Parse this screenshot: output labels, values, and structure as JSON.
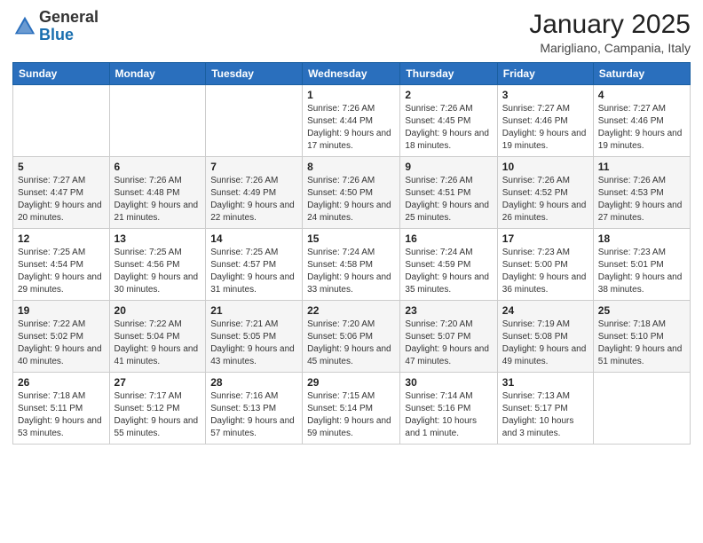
{
  "header": {
    "logo_line1": "General",
    "logo_line2": "Blue",
    "month": "January 2025",
    "location": "Marigliano, Campania, Italy"
  },
  "weekdays": [
    "Sunday",
    "Monday",
    "Tuesday",
    "Wednesday",
    "Thursday",
    "Friday",
    "Saturday"
  ],
  "weeks": [
    [
      {
        "day": "",
        "info": ""
      },
      {
        "day": "",
        "info": ""
      },
      {
        "day": "",
        "info": ""
      },
      {
        "day": "1",
        "info": "Sunrise: 7:26 AM\nSunset: 4:44 PM\nDaylight: 9 hours and 17 minutes."
      },
      {
        "day": "2",
        "info": "Sunrise: 7:26 AM\nSunset: 4:45 PM\nDaylight: 9 hours and 18 minutes."
      },
      {
        "day": "3",
        "info": "Sunrise: 7:27 AM\nSunset: 4:46 PM\nDaylight: 9 hours and 19 minutes."
      },
      {
        "day": "4",
        "info": "Sunrise: 7:27 AM\nSunset: 4:46 PM\nDaylight: 9 hours and 19 minutes."
      }
    ],
    [
      {
        "day": "5",
        "info": "Sunrise: 7:27 AM\nSunset: 4:47 PM\nDaylight: 9 hours and 20 minutes."
      },
      {
        "day": "6",
        "info": "Sunrise: 7:26 AM\nSunset: 4:48 PM\nDaylight: 9 hours and 21 minutes."
      },
      {
        "day": "7",
        "info": "Sunrise: 7:26 AM\nSunset: 4:49 PM\nDaylight: 9 hours and 22 minutes."
      },
      {
        "day": "8",
        "info": "Sunrise: 7:26 AM\nSunset: 4:50 PM\nDaylight: 9 hours and 24 minutes."
      },
      {
        "day": "9",
        "info": "Sunrise: 7:26 AM\nSunset: 4:51 PM\nDaylight: 9 hours and 25 minutes."
      },
      {
        "day": "10",
        "info": "Sunrise: 7:26 AM\nSunset: 4:52 PM\nDaylight: 9 hours and 26 minutes."
      },
      {
        "day": "11",
        "info": "Sunrise: 7:26 AM\nSunset: 4:53 PM\nDaylight: 9 hours and 27 minutes."
      }
    ],
    [
      {
        "day": "12",
        "info": "Sunrise: 7:25 AM\nSunset: 4:54 PM\nDaylight: 9 hours and 29 minutes."
      },
      {
        "day": "13",
        "info": "Sunrise: 7:25 AM\nSunset: 4:56 PM\nDaylight: 9 hours and 30 minutes."
      },
      {
        "day": "14",
        "info": "Sunrise: 7:25 AM\nSunset: 4:57 PM\nDaylight: 9 hours and 31 minutes."
      },
      {
        "day": "15",
        "info": "Sunrise: 7:24 AM\nSunset: 4:58 PM\nDaylight: 9 hours and 33 minutes."
      },
      {
        "day": "16",
        "info": "Sunrise: 7:24 AM\nSunset: 4:59 PM\nDaylight: 9 hours and 35 minutes."
      },
      {
        "day": "17",
        "info": "Sunrise: 7:23 AM\nSunset: 5:00 PM\nDaylight: 9 hours and 36 minutes."
      },
      {
        "day": "18",
        "info": "Sunrise: 7:23 AM\nSunset: 5:01 PM\nDaylight: 9 hours and 38 minutes."
      }
    ],
    [
      {
        "day": "19",
        "info": "Sunrise: 7:22 AM\nSunset: 5:02 PM\nDaylight: 9 hours and 40 minutes."
      },
      {
        "day": "20",
        "info": "Sunrise: 7:22 AM\nSunset: 5:04 PM\nDaylight: 9 hours and 41 minutes."
      },
      {
        "day": "21",
        "info": "Sunrise: 7:21 AM\nSunset: 5:05 PM\nDaylight: 9 hours and 43 minutes."
      },
      {
        "day": "22",
        "info": "Sunrise: 7:20 AM\nSunset: 5:06 PM\nDaylight: 9 hours and 45 minutes."
      },
      {
        "day": "23",
        "info": "Sunrise: 7:20 AM\nSunset: 5:07 PM\nDaylight: 9 hours and 47 minutes."
      },
      {
        "day": "24",
        "info": "Sunrise: 7:19 AM\nSunset: 5:08 PM\nDaylight: 9 hours and 49 minutes."
      },
      {
        "day": "25",
        "info": "Sunrise: 7:18 AM\nSunset: 5:10 PM\nDaylight: 9 hours and 51 minutes."
      }
    ],
    [
      {
        "day": "26",
        "info": "Sunrise: 7:18 AM\nSunset: 5:11 PM\nDaylight: 9 hours and 53 minutes."
      },
      {
        "day": "27",
        "info": "Sunrise: 7:17 AM\nSunset: 5:12 PM\nDaylight: 9 hours and 55 minutes."
      },
      {
        "day": "28",
        "info": "Sunrise: 7:16 AM\nSunset: 5:13 PM\nDaylight: 9 hours and 57 minutes."
      },
      {
        "day": "29",
        "info": "Sunrise: 7:15 AM\nSunset: 5:14 PM\nDaylight: 9 hours and 59 minutes."
      },
      {
        "day": "30",
        "info": "Sunrise: 7:14 AM\nSunset: 5:16 PM\nDaylight: 10 hours and 1 minute."
      },
      {
        "day": "31",
        "info": "Sunrise: 7:13 AM\nSunset: 5:17 PM\nDaylight: 10 hours and 3 minutes."
      },
      {
        "day": "",
        "info": ""
      }
    ]
  ]
}
